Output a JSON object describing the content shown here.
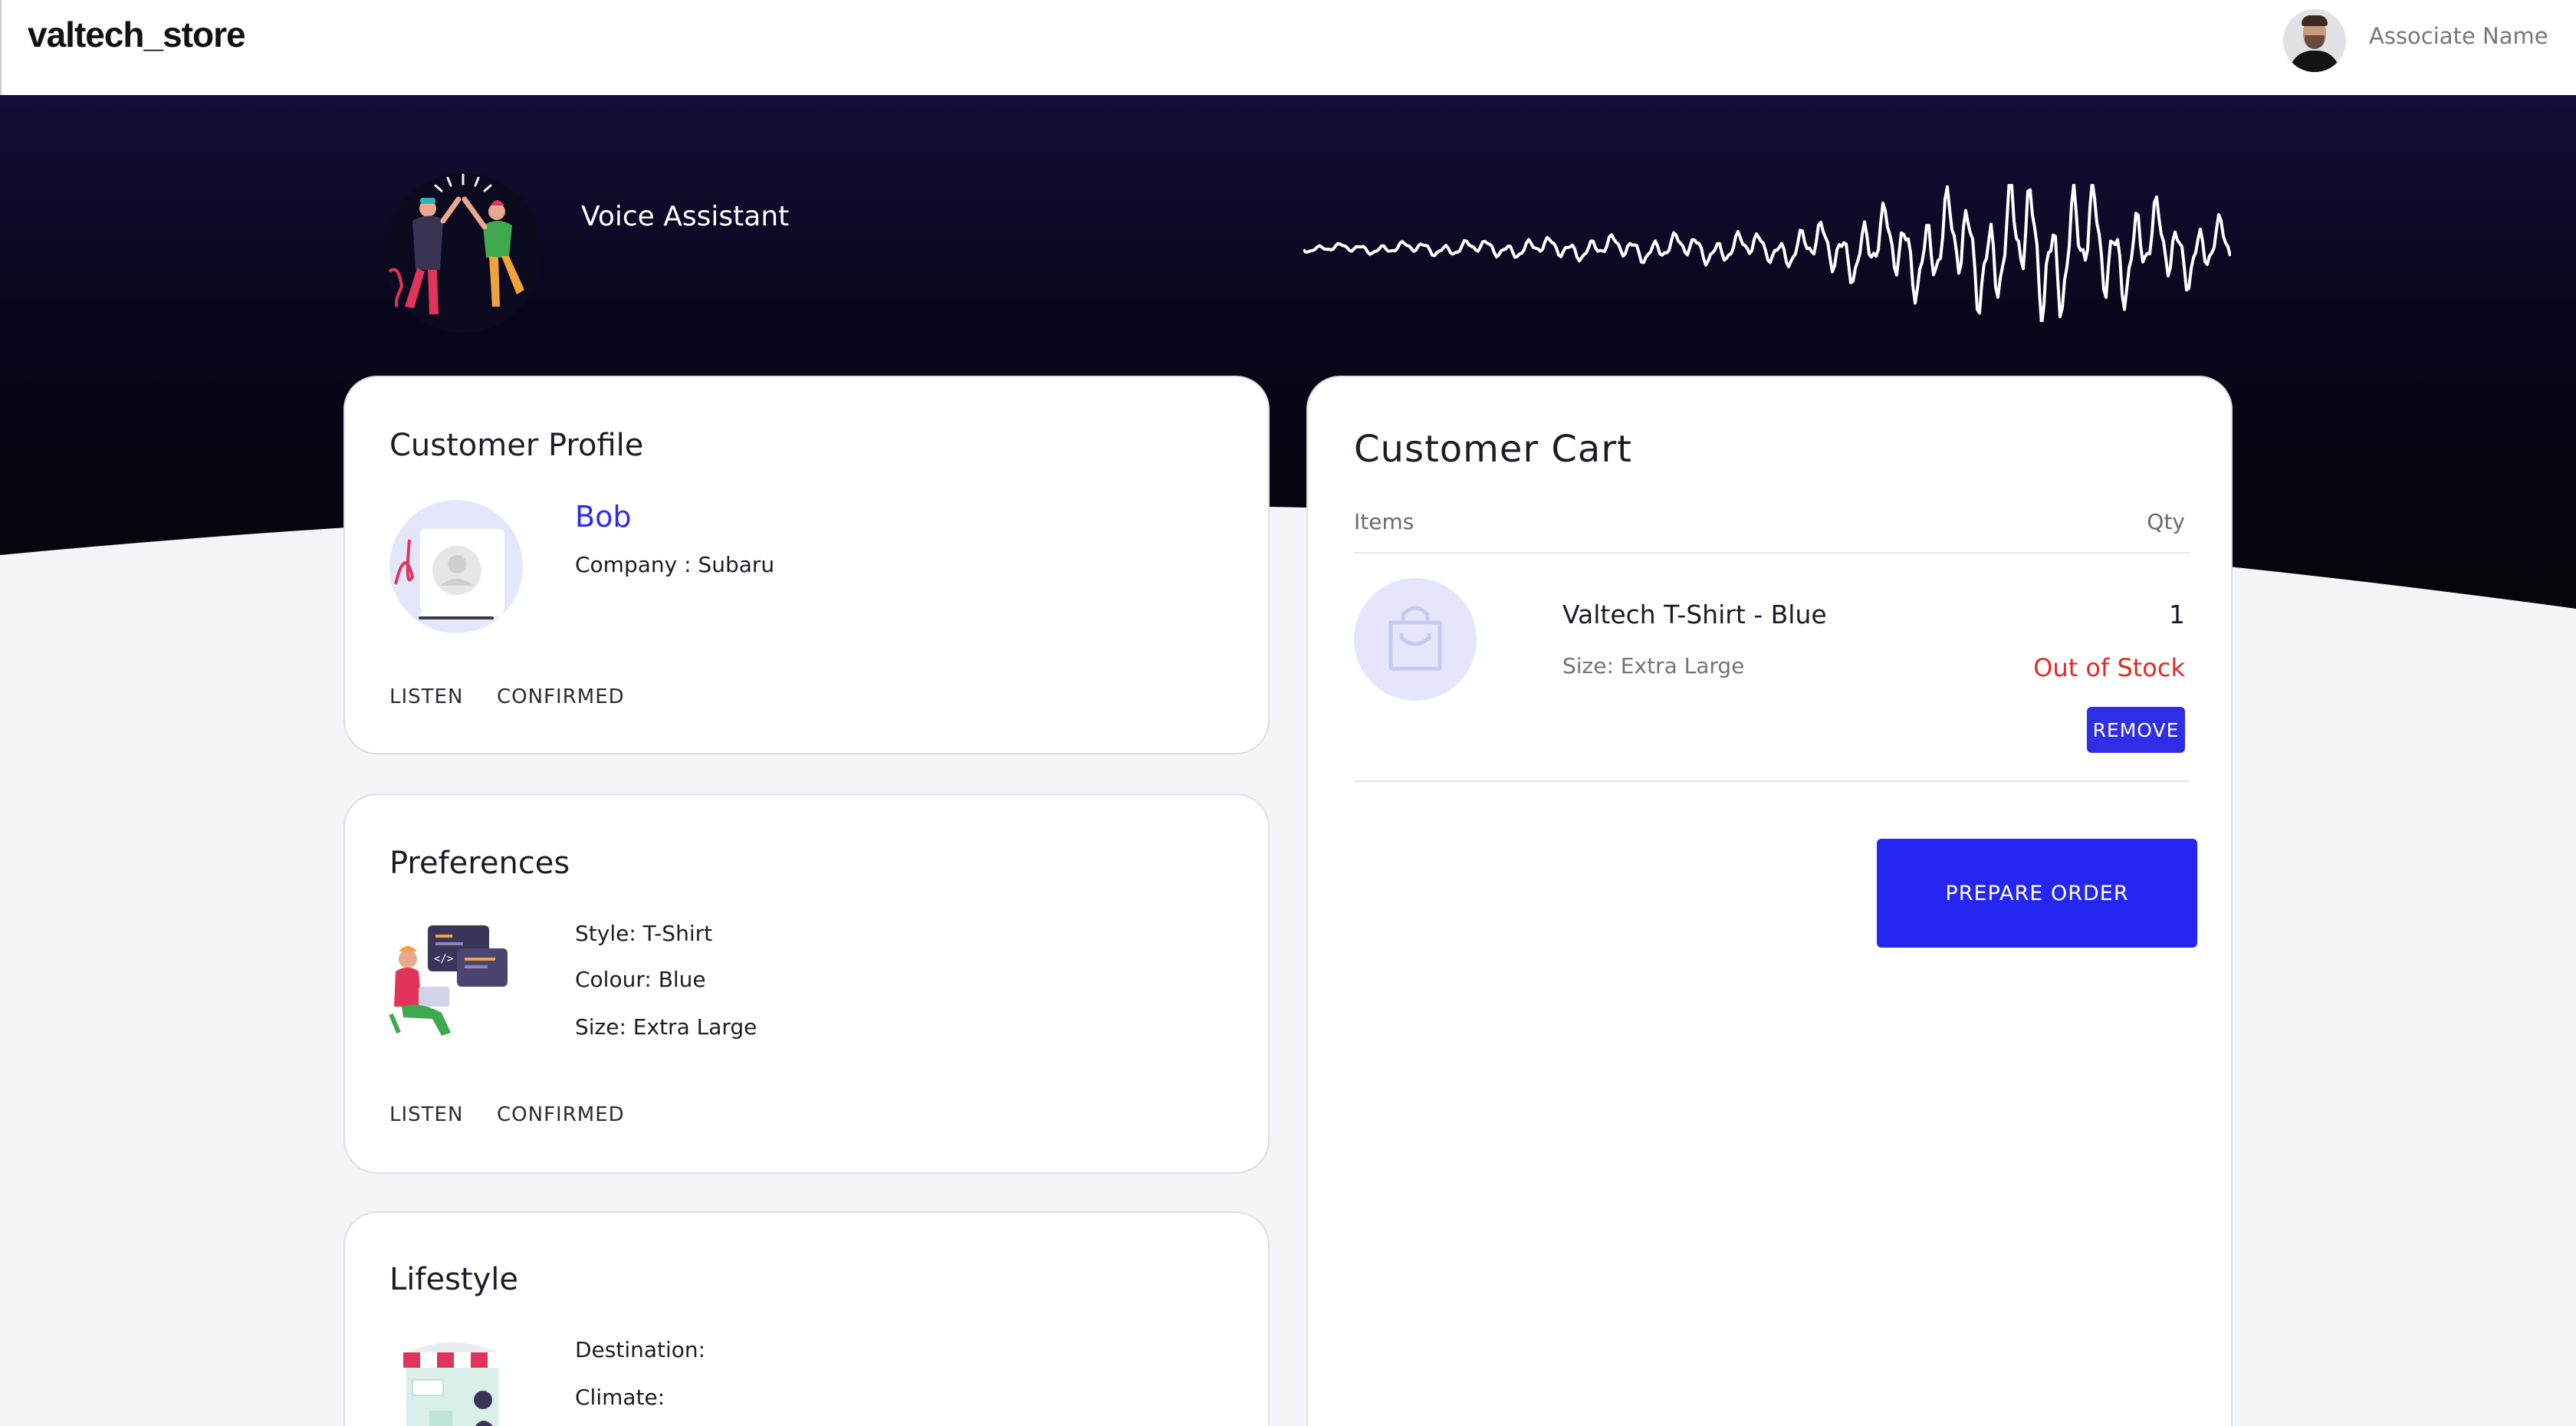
{
  "header": {
    "brand": "valtech_store",
    "associate_name": "Associate Name"
  },
  "hero": {
    "title": "Voice Assistant"
  },
  "profile": {
    "title": "Customer Profile",
    "name": "Bob",
    "company": "Company : Subaru",
    "listen_label": "LISTEN",
    "confirmed_label": "CONFIRMED"
  },
  "preferences": {
    "title": "Preferences",
    "style": "Style: T-Shirt",
    "colour": "Colour: Blue",
    "size": "Size: Extra Large",
    "listen_label": "LISTEN",
    "confirmed_label": "CONFIRMED"
  },
  "lifestyle": {
    "title": "Lifestyle",
    "destination": "Destination:",
    "climate": "Climate:"
  },
  "cart": {
    "title": "Customer Cart",
    "items_header": "Items",
    "qty_header": "Qty",
    "items": [
      {
        "name": "Valtech T-Shirt - Blue",
        "size": "Size: Extra Large",
        "qty": "1",
        "stock_status": "Out of Stock",
        "remove_label": "REMOVE"
      }
    ],
    "prepare_label": "PREPARE ORDER"
  },
  "colors": {
    "accent": "#2f2ee6",
    "hero_dark": "#06040f",
    "hero_top": "#130b33",
    "out_of_stock": "#e02a21"
  }
}
